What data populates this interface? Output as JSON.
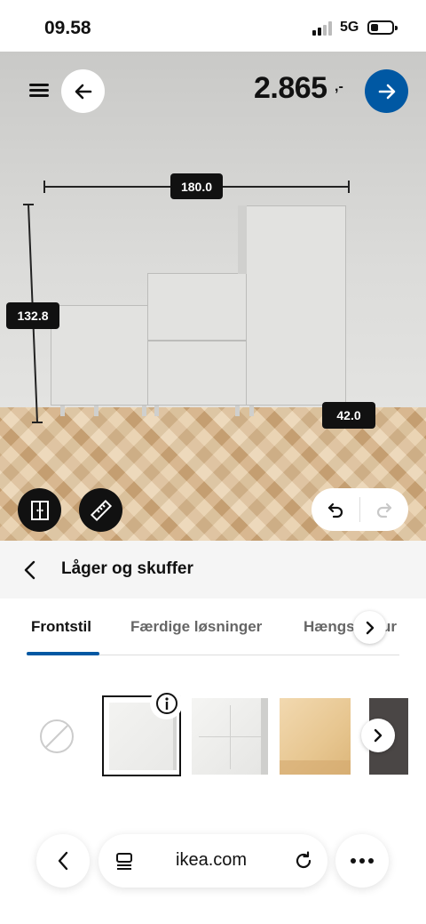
{
  "status_bar": {
    "time": "09.58",
    "network": "5G"
  },
  "planner": {
    "price": "2.865",
    "price_suffix": ",-",
    "dimensions": {
      "width": "180.0",
      "height": "132.8",
      "depth": "42.0"
    }
  },
  "panel": {
    "title": "Låger og skuffer",
    "tabs": [
      "Frontstil",
      "Færdige løsninger",
      "Hængs",
      "ur"
    ]
  },
  "browser": {
    "url": "ikea.com"
  },
  "icons": {
    "menu": "hamburger-icon",
    "back": "arrow-left-icon",
    "next": "arrow-right-icon",
    "doors": "door-toggle-icon",
    "measure": "ruler-icon",
    "undo": "undo-icon",
    "redo": "redo-icon",
    "info": "info-icon",
    "none": "no-selection-icon",
    "reader": "reader-icon",
    "reload": "reload-icon",
    "more": "more-icon"
  },
  "colors": {
    "accent": "#0058a3",
    "dark": "#111111"
  }
}
